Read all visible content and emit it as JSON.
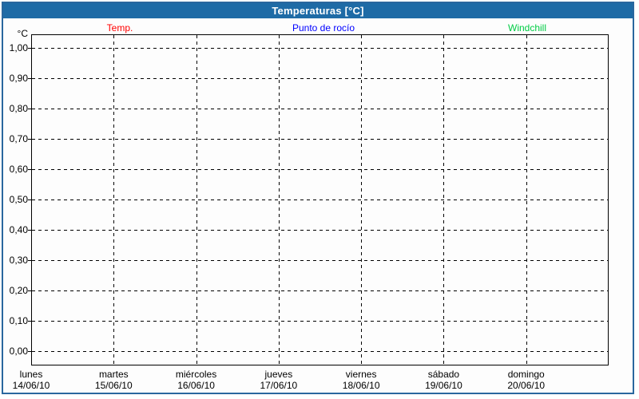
{
  "window": {
    "title": "Temperaturas [°C]",
    "colors": {
      "titlebar_bg": "#1E6BA6",
      "frame_border": "#2A679E",
      "content_bg": "#FDFDFD",
      "grid": "#000000",
      "temp": "#FF0000",
      "dew_point": "#0000FF",
      "windchill": "#00CC44"
    }
  },
  "legend": {
    "items": [
      {
        "label": "Temp.",
        "color": "#FF0000"
      },
      {
        "label": "Punto de rocío",
        "color": "#0000FF"
      },
      {
        "label": "Windchill",
        "color": "#00CC44"
      }
    ]
  },
  "y_axis": {
    "unit": "°C",
    "tick_labels": [
      "1,00",
      "0,90",
      "0,80",
      "0,70",
      "0,60",
      "0,50",
      "0,40",
      "0,30",
      "0,20",
      "0,10",
      "0,00"
    ]
  },
  "x_axis": {
    "days": [
      {
        "name": "lunes",
        "date": "14/06/10"
      },
      {
        "name": "martes",
        "date": "15/06/10"
      },
      {
        "name": "miércoles",
        "date": "16/06/10"
      },
      {
        "name": "jueves",
        "date": "17/06/10"
      },
      {
        "name": "viernes",
        "date": "18/06/10"
      },
      {
        "name": "sábado",
        "date": "19/06/10"
      },
      {
        "name": "domingo",
        "date": "20/06/10"
      }
    ]
  },
  "chart_data": {
    "type": "line",
    "title": "Temperaturas [°C]",
    "xlabel": "",
    "ylabel": "°C",
    "ylim": [
      0.0,
      1.0
    ],
    "y_tick_step": 0.1,
    "y_ticks": [
      1.0,
      0.9,
      0.8,
      0.7,
      0.6,
      0.5,
      0.4,
      0.3,
      0.2,
      0.1,
      0.0
    ],
    "x_categories": [
      "lunes 14/06/10",
      "martes 15/06/10",
      "miércoles 16/06/10",
      "jueves 17/06/10",
      "viernes 18/06/10",
      "sábado 19/06/10",
      "domingo 20/06/10"
    ],
    "series": [
      {
        "name": "Temp.",
        "color": "#FF0000",
        "values": []
      },
      {
        "name": "Punto de rocío",
        "color": "#0000FF",
        "values": []
      },
      {
        "name": "Windchill",
        "color": "#00CC44",
        "values": []
      }
    ],
    "grid": "dashed",
    "legend_position": "top"
  }
}
